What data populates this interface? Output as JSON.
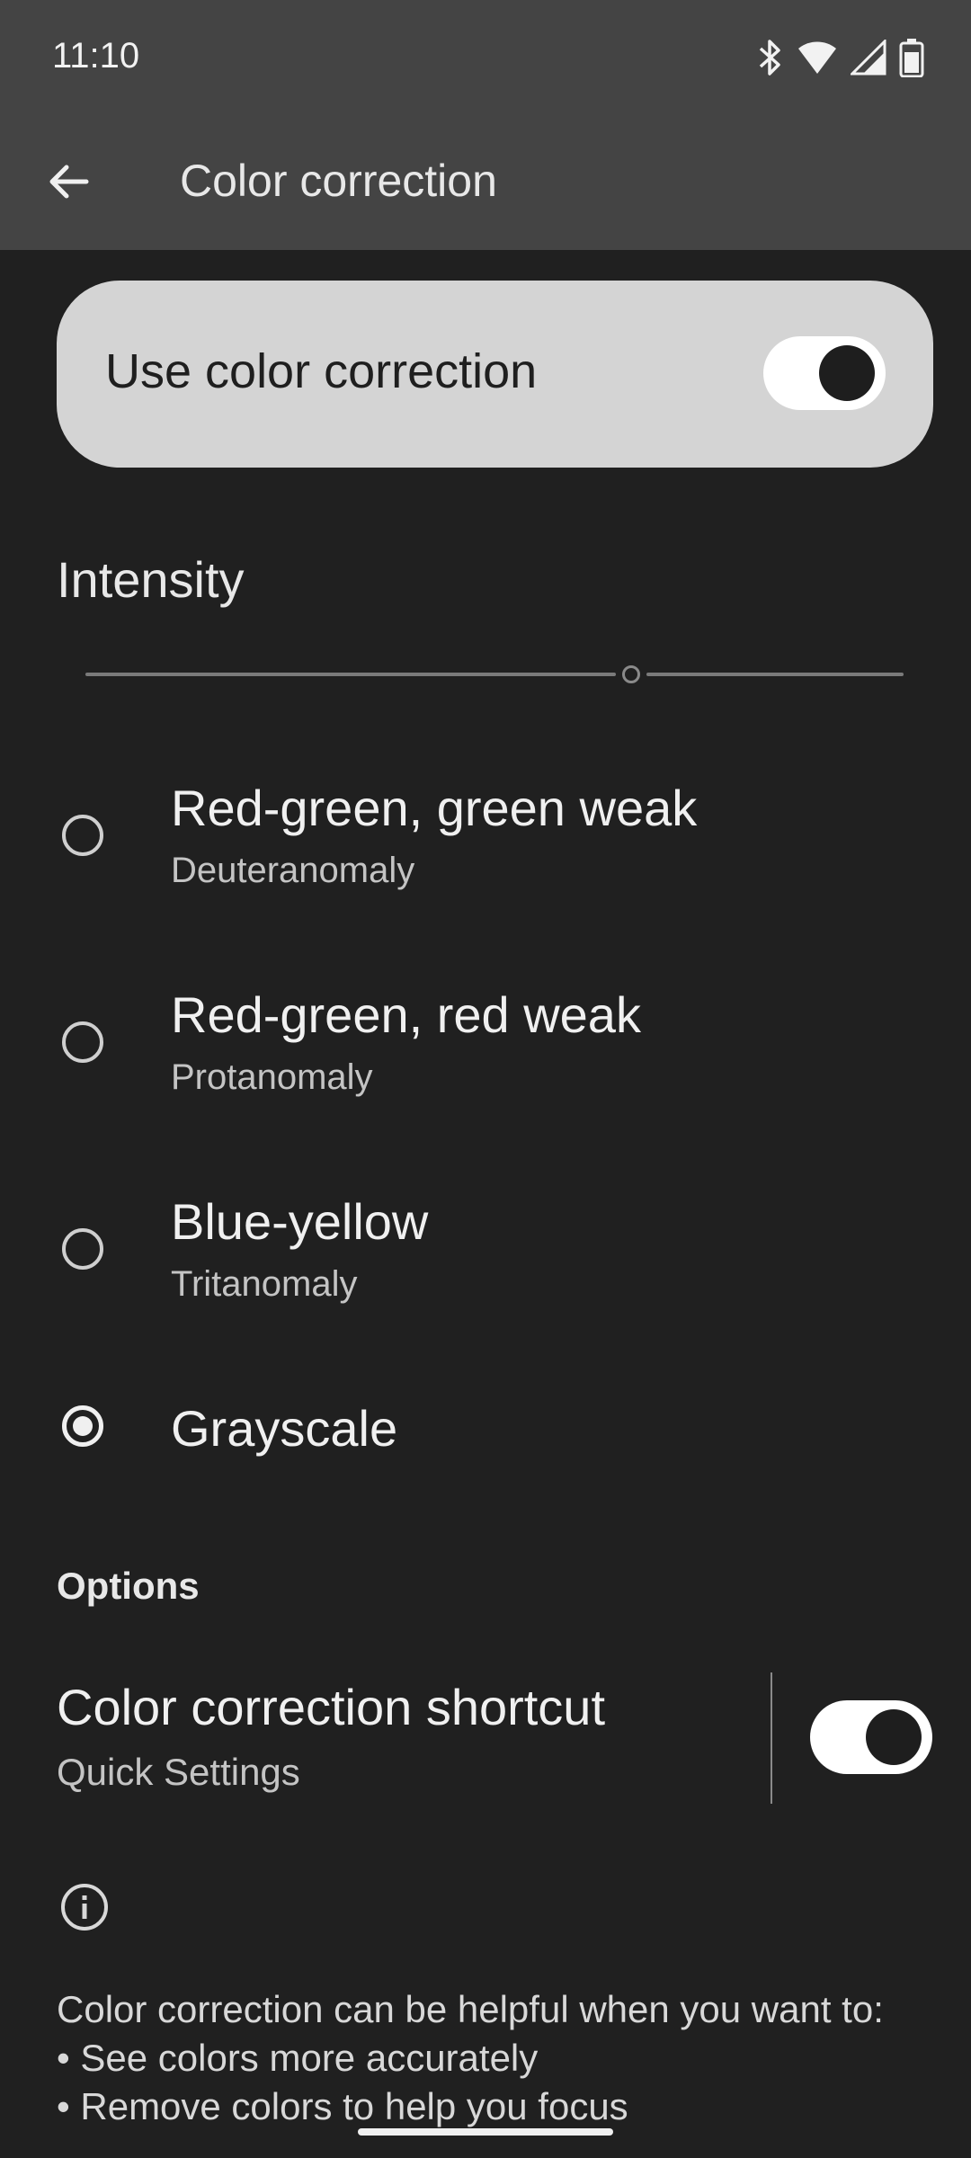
{
  "status_bar": {
    "time": "11:10",
    "icons": [
      "bluetooth-icon",
      "wifi-icon",
      "signal-icon",
      "battery-icon"
    ]
  },
  "app_bar": {
    "back_icon": "arrow-back-icon",
    "title": "Color correction"
  },
  "master_toggle": {
    "label": "Use color correction",
    "on": true
  },
  "intensity": {
    "label": "Intensity",
    "value_fraction": 0.66
  },
  "modes": [
    {
      "title": "Red-green, green weak",
      "subtitle": "Deuteranomaly",
      "selected": false
    },
    {
      "title": "Red-green, red weak",
      "subtitle": "Protanomaly",
      "selected": false
    },
    {
      "title": "Blue-yellow",
      "subtitle": "Tritanomaly",
      "selected": false
    },
    {
      "title": "Grayscale",
      "subtitle": "",
      "selected": true
    }
  ],
  "options": {
    "header": "Options",
    "shortcut": {
      "title": "Color correction shortcut",
      "subtitle": "Quick Settings",
      "on": true
    }
  },
  "footer": {
    "info_icon": "info-icon",
    "intro": "Color correction can be helpful when you want to:",
    "bullets": [
      "• See colors more accurately",
      "• Remove colors to help you focus"
    ]
  },
  "colors": {
    "background": "#202020",
    "bar": "#444444",
    "card": "#d4d4d4"
  }
}
